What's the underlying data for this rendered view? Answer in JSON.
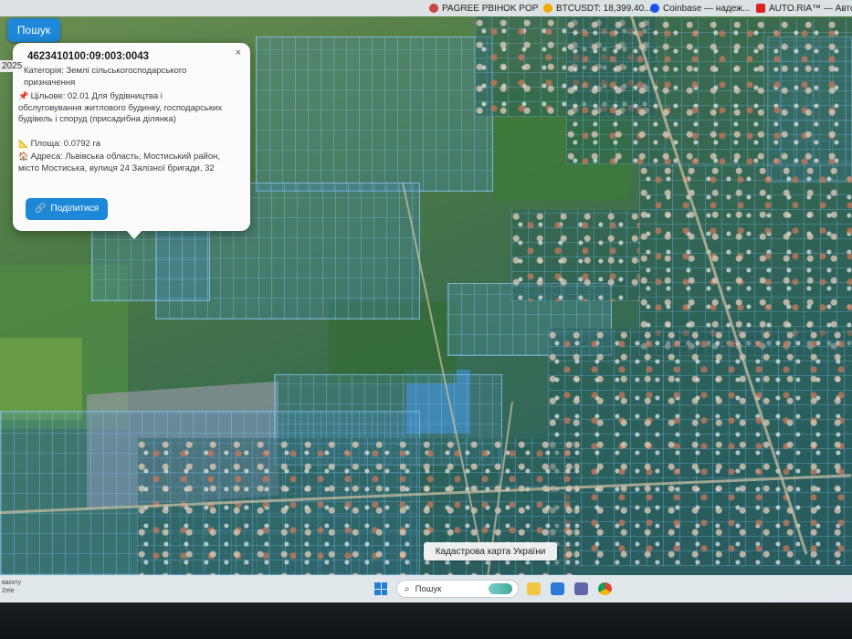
{
  "browser": {
    "bookmarks": [
      {
        "label": "PAGREE PBIHOK POP",
        "icon": "bookmark-icon",
        "color": "#c44"
      },
      {
        "label": "BTCUSDT: 18,399.40...",
        "icon": "btc-icon",
        "color": "#f2a900"
      },
      {
        "label": "Coinbase — надеж...",
        "icon": "coinbase-icon",
        "color": "#1652f0"
      },
      {
        "label": "AUTO.RIA™ — Авто...",
        "icon": "autoria-icon",
        "color": "#d22"
      }
    ]
  },
  "search": {
    "button_label": "Пошук",
    "date_fragment": "2025"
  },
  "popup": {
    "cadastral_number": "4623410100:09:003:0043",
    "close_label": "×",
    "category_icon": "category-icon",
    "category_text": "Категорія: Землі сільськогосподарського призначення",
    "purpose_icon": "pin-icon",
    "purpose_text": "Цільове: 02.01 Для будівництва і обслуговування житлового будинку, господарських будівель і споруд (присадибна ділянка)",
    "area_icon": "ruler-icon",
    "area_text": "Площа: 0.0792 га",
    "address_icon": "house-icon",
    "address_text": "Адреса: Львівська область, Мостиський район, місто Мостиська, вулиця 24 Залізної бригади, 32",
    "share_label": "Поділитися",
    "share_icon": "link-icon"
  },
  "map": {
    "label": "Кадастрова карта України"
  },
  "taskbar": {
    "left_text_1": "ваєкту",
    "left_text_2": "Zele",
    "search_placeholder": "Пошук",
    "icons": [
      "start-icon",
      "search-icon",
      "widget-icon",
      "file-explorer-icon",
      "store-icon",
      "teams-icon",
      "chrome-icon"
    ]
  },
  "colors": {
    "accent": "#1e88d8",
    "parcel_outline": "#8cc8ff"
  }
}
